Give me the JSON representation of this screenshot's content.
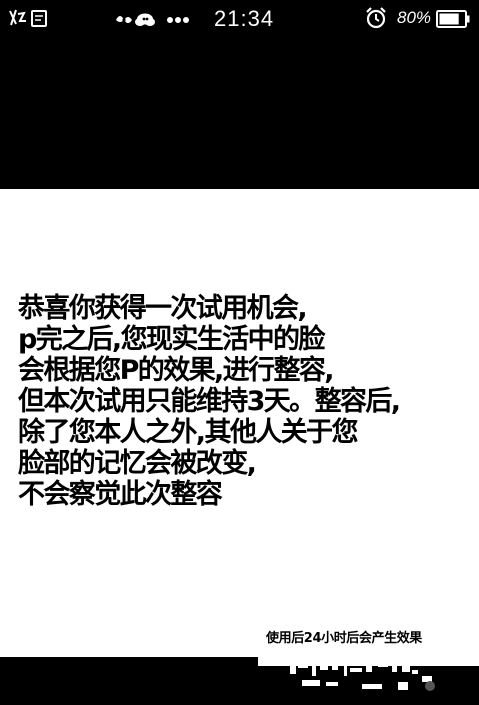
{
  "status_bar": {
    "time": "21:34",
    "battery_percent": "80%",
    "battery_level": 0.8,
    "left_icons": [
      "notification-icon",
      "notification-icon"
    ],
    "mid_icons": [
      "fan-icon",
      "cloud-icon",
      "more-dots-icon"
    ],
    "right_icons": [
      "alarm-icon",
      "battery-icon"
    ]
  },
  "message": {
    "lines": [
      "恭喜你获得一次试用机会,",
      "p完之后,您现实生活中的脸",
      "会根据您P的效果,进行整容,",
      "但本次试用只能维持3天。整容后,",
      "除了您本人之外,其他人关于您",
      "脸部的记忆会被改变,",
      "不会察觉此次整容"
    ]
  },
  "caption": {
    "text": "使用后24小时后会产生效果"
  }
}
